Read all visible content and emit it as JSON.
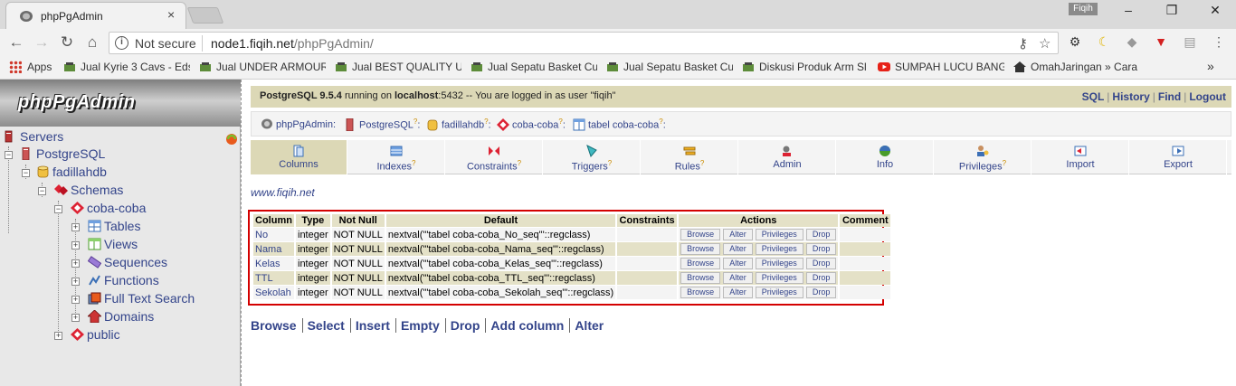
{
  "browser": {
    "tab_title": "phpPgAdmin",
    "tab_close": "×",
    "user_badge": "Fiqih",
    "not_secure": "Not secure",
    "url_host": "node1.fiqih.net",
    "url_path": "/phpPgAdmin/",
    "bookmarks": [
      "Apps",
      "Jual Kyrie 3 Cavs - Eds",
      "Jual UNDER ARMOUR",
      "Jual BEST QUALITY Ur",
      "Jual Sepatu Basket Cu",
      "Jual Sepatu Basket Cu",
      "Diskusi Produk Arm Sl",
      "SUMPAH LUCU BANG",
      "OmahJaringan » Cara"
    ],
    "more_bookmarks": "»"
  },
  "sidebar": {
    "logo": "phpPgAdmin",
    "tree": [
      {
        "label": "Servers"
      },
      {
        "label": "PostgreSQL"
      },
      {
        "label": "fadillahdb"
      },
      {
        "label": "Schemas"
      },
      {
        "label": "coba-coba"
      },
      {
        "label": "Tables"
      },
      {
        "label": "Views"
      },
      {
        "label": "Sequences"
      },
      {
        "label": "Functions"
      },
      {
        "label": "Full Text Search"
      },
      {
        "label": "Domains"
      },
      {
        "label": "public"
      }
    ]
  },
  "topbar": {
    "version": "PostgreSQL 9.5.4",
    "running_on": " running on ",
    "host": "localhost",
    "port_text": ":5432 -- You are logged in as user \"fiqih\"",
    "links": [
      "SQL",
      "History",
      "Find",
      "Logout"
    ]
  },
  "trail": [
    {
      "label": "phpPgAdmin:",
      "help": ""
    },
    {
      "label": "PostgreSQL",
      "help": "?"
    },
    {
      "label": "fadillahdb",
      "help": "?"
    },
    {
      "label": "coba-coba",
      "help": "?"
    },
    {
      "label": "tabel coba-coba",
      "help": "?"
    }
  ],
  "trail_colon": ":",
  "tabs": [
    {
      "label": "Columns",
      "help": "",
      "active": true
    },
    {
      "label": "Indexes",
      "help": "?"
    },
    {
      "label": "Constraints",
      "help": "?"
    },
    {
      "label": "Triggers",
      "help": "?"
    },
    {
      "label": "Rules",
      "help": "?"
    },
    {
      "label": "Admin",
      "help": ""
    },
    {
      "label": "Info",
      "help": ""
    },
    {
      "label": "Privileges",
      "help": "?"
    },
    {
      "label": "Import",
      "help": ""
    },
    {
      "label": "Export",
      "help": ""
    }
  ],
  "site_link": "www.fiqih.net",
  "table": {
    "headers": [
      "Column",
      "Type",
      "Not Null",
      "Default",
      "Constraints",
      "Actions",
      "Comment"
    ],
    "action_labels": [
      "Browse",
      "Alter",
      "Privileges",
      "Drop"
    ],
    "rows": [
      {
        "column": "No",
        "type": "integer",
        "not_null": "NOT NULL",
        "default": "nextval('\"tabel coba-coba_No_seq\"'::regclass)",
        "constraints": "",
        "comment": ""
      },
      {
        "column": "Nama",
        "type": "integer",
        "not_null": "NOT NULL",
        "default": "nextval('\"tabel coba-coba_Nama_seq\"'::regclass)",
        "constraints": "",
        "comment": ""
      },
      {
        "column": "Kelas",
        "type": "integer",
        "not_null": "NOT NULL",
        "default": "nextval('\"tabel coba-coba_Kelas_seq\"'::regclass)",
        "constraints": "",
        "comment": ""
      },
      {
        "column": "TTL",
        "type": "integer",
        "not_null": "NOT NULL",
        "default": "nextval('\"tabel coba-coba_TTL_seq\"'::regclass)",
        "constraints": "",
        "comment": ""
      },
      {
        "column": "Sekolah",
        "type": "integer",
        "not_null": "NOT NULL",
        "default": "nextval('\"tabel coba-coba_Sekolah_seq\"'::regclass)",
        "constraints": "",
        "comment": ""
      }
    ]
  },
  "bottom_actions": [
    "Browse",
    "Select",
    "Insert",
    "Empty",
    "Drop",
    "Add column",
    "Alter"
  ],
  "colors": {
    "link": "#33448a",
    "header_bg": "#dcd8b6",
    "highlight_border": "#d40000"
  }
}
